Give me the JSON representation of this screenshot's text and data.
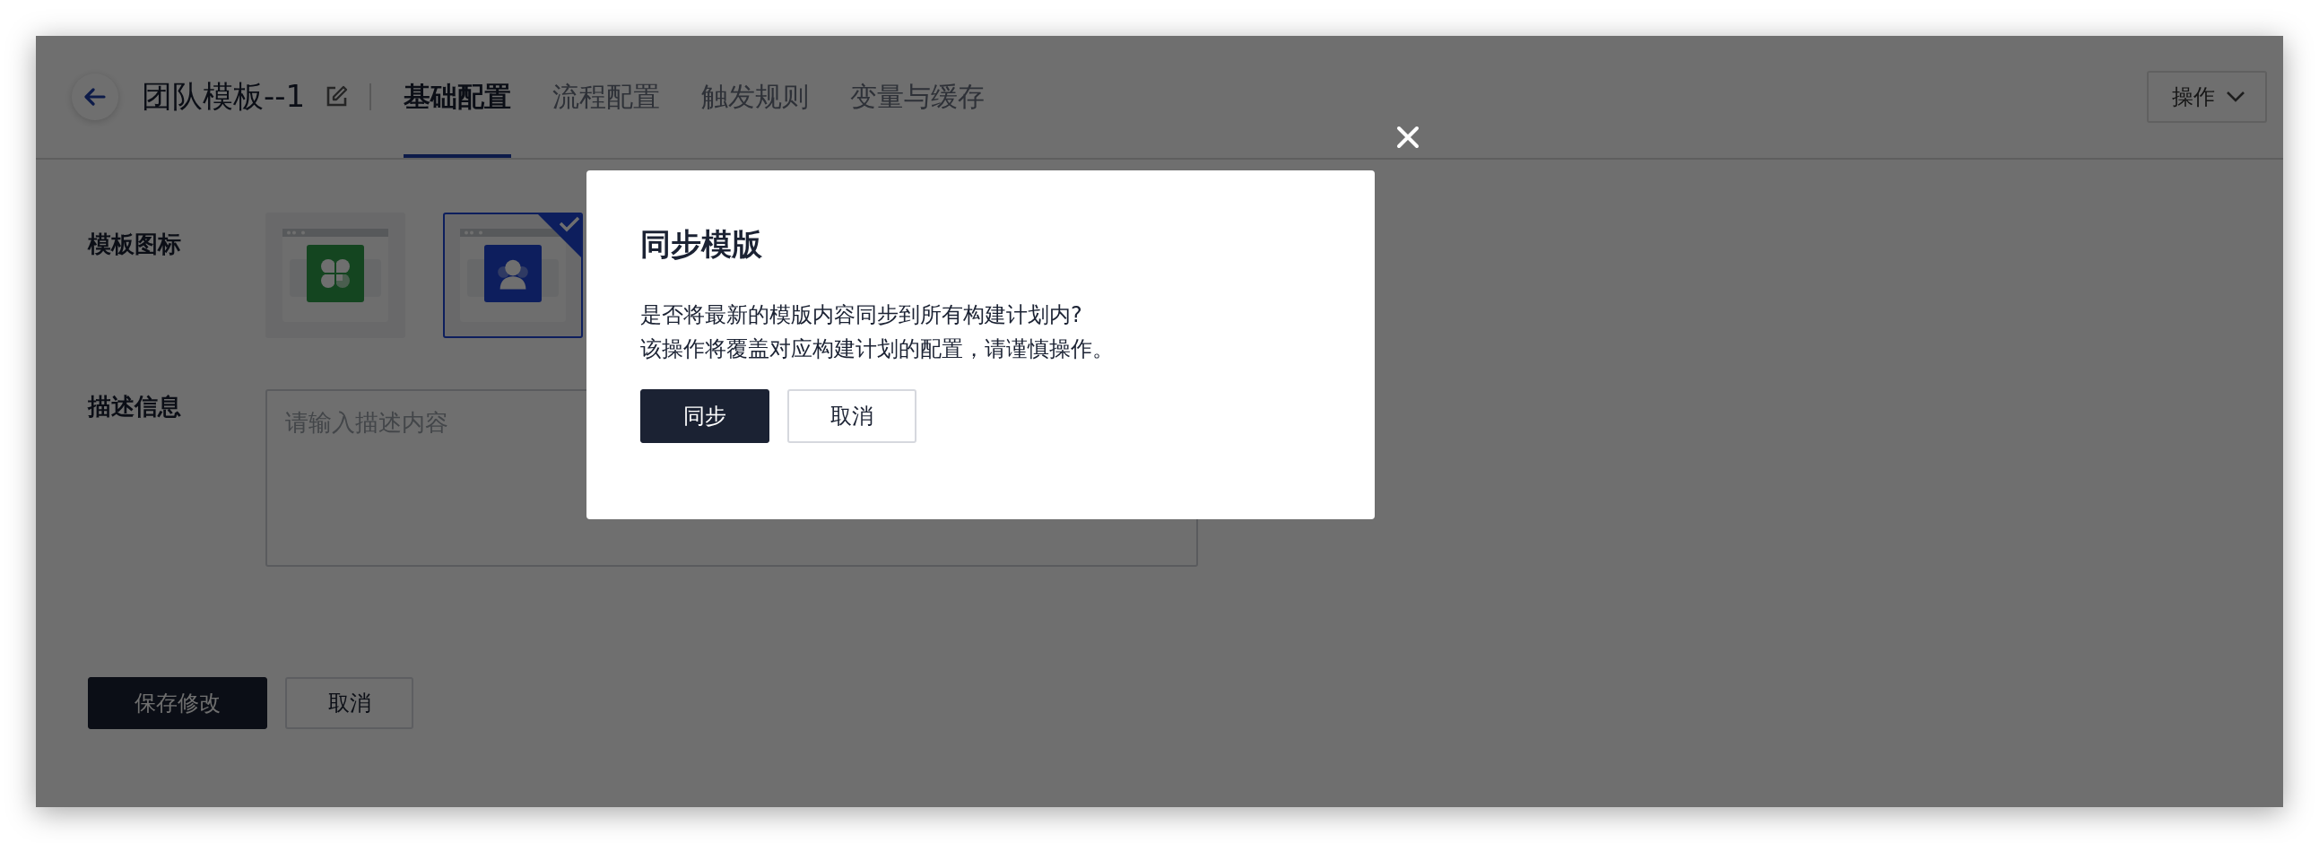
{
  "header": {
    "title": "团队模板--1",
    "tabs": [
      {
        "label": "基础配置",
        "selected": true
      },
      {
        "label": "流程配置",
        "selected": false
      },
      {
        "label": "触发规则",
        "selected": false
      },
      {
        "label": "变量与缓存",
        "selected": false
      }
    ],
    "actions_button": "操作"
  },
  "form": {
    "icon_label": "模板图标",
    "icons": [
      {
        "kind": "clover",
        "selected": false
      },
      {
        "kind": "person",
        "selected": true
      }
    ],
    "description_label": "描述信息",
    "description": {
      "placeholder": "请输入描述内容"
    },
    "buttons": [
      {
        "kind": "primary",
        "label": "保存修改"
      },
      {
        "kind": "default",
        "label": "取消"
      }
    ]
  },
  "dialog": {
    "title": "同步模版",
    "message": [
      "是否将最新的模版内容同步到所有构建计划内?",
      "该操作将覆盖对应构建计划的配置，请谨慎操作。"
    ],
    "buttons": [
      {
        "kind": "primary",
        "label": "同步"
      },
      {
        "kind": "default",
        "label": "取消"
      }
    ]
  }
}
